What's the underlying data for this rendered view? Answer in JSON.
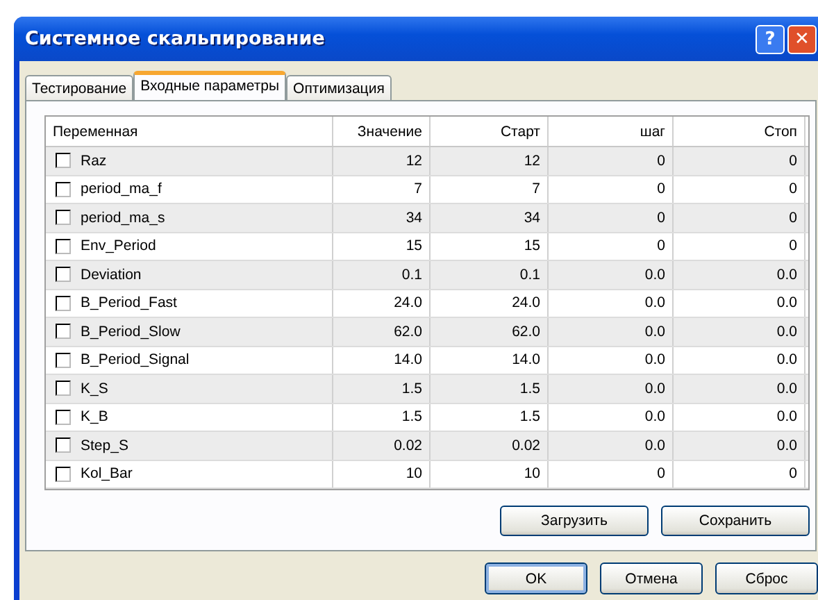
{
  "window": {
    "title": "Системное скальпирование",
    "controls": [
      "?",
      "✕"
    ]
  },
  "tabs": [
    {
      "label": "Тестирование",
      "selected": false
    },
    {
      "label": "Входные параметры",
      "selected": true
    },
    {
      "label": "Оптимизация",
      "selected": false
    }
  ],
  "table": {
    "columns": [
      "Переменная",
      "Значение",
      "Старт",
      "шаг",
      "Стоп"
    ],
    "rows": [
      {
        "checked": false,
        "cells": [
          "Raz",
          "12",
          "12",
          "0",
          "0"
        ]
      },
      {
        "checked": false,
        "cells": [
          "period_ma_f",
          "7",
          "7",
          "0",
          "0"
        ]
      },
      {
        "checked": false,
        "cells": [
          "period_ma_s",
          "34",
          "34",
          "0",
          "0"
        ]
      },
      {
        "checked": false,
        "cells": [
          "Env_Period",
          "15",
          "15",
          "0",
          "0"
        ]
      },
      {
        "checked": false,
        "cells": [
          "Deviation",
          "0.1",
          "0.1",
          "0.0",
          "0.0"
        ]
      },
      {
        "checked": false,
        "cells": [
          "B_Period_Fast",
          "24.0",
          "24.0",
          "0.0",
          "0.0"
        ]
      },
      {
        "checked": false,
        "cells": [
          "B_Period_Slow",
          "62.0",
          "62.0",
          "0.0",
          "0.0"
        ]
      },
      {
        "checked": false,
        "cells": [
          "B_Period_Signal",
          "14.0",
          "14.0",
          "0.0",
          "0.0"
        ]
      },
      {
        "checked": false,
        "cells": [
          "K_S",
          "1.5",
          "1.5",
          "0.0",
          "0.0"
        ]
      },
      {
        "checked": false,
        "cells": [
          "K_B",
          "1.5",
          "1.5",
          "0.0",
          "0.0"
        ]
      },
      {
        "checked": false,
        "cells": [
          "Step_S",
          "0.02",
          "0.02",
          "0.0",
          "0.0"
        ]
      },
      {
        "checked": false,
        "cells": [
          "Kol_Bar",
          "10",
          "10",
          "0",
          "0"
        ]
      }
    ]
  },
  "panel_buttons": [
    "Загрузить",
    "Сохранить"
  ],
  "dialog_buttons": [
    {
      "label": "OK",
      "default": true
    },
    {
      "label": "Отмена",
      "default": false
    },
    {
      "label": "Сброс",
      "default": false
    }
  ]
}
